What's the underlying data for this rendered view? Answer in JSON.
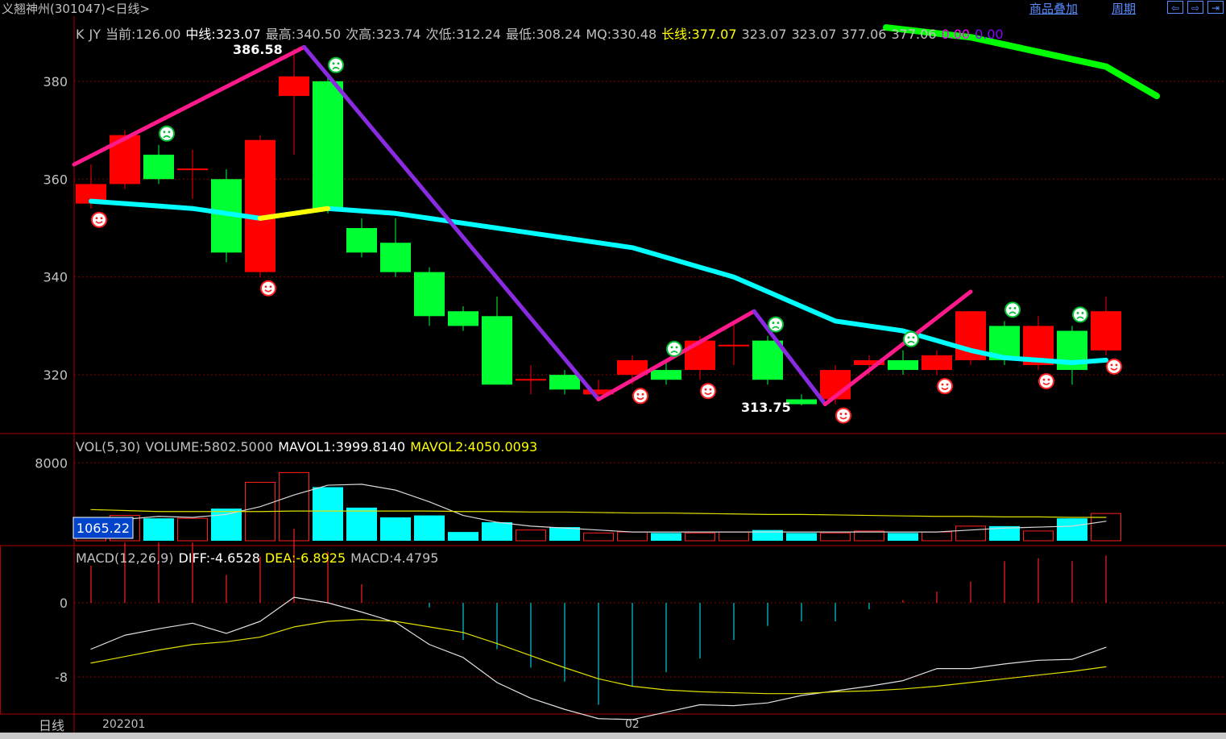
{
  "window": {
    "title": "义翘神州(301047)<日线>",
    "links": [
      "商品叠加",
      "周期"
    ],
    "nav_buttons": [
      "⇦",
      "⇨",
      "⇥"
    ]
  },
  "price_panel": {
    "header": {
      "k_label": "K",
      "jy_label": "JY",
      "current": "当前:126.00",
      "mid": "中线:323.07",
      "high": "最高:340.50",
      "sub_high": "次高:323.74",
      "sub_low": "次低:312.24",
      "low": "最低:308.24",
      "mq": "MQ:330.48",
      "long": "长线:377.07",
      "v1": "323.07",
      "v2": "323.07",
      "v3": "377.06",
      "v4": "377.06",
      "v5": "0.00",
      "v6": "0.00"
    },
    "y_ticks": [
      "380",
      "360",
      "340",
      "320"
    ],
    "annotations": {
      "peak": "386.58",
      "trough": "313.75"
    }
  },
  "volume_panel": {
    "header": {
      "name": "VOL(5,30)",
      "volume": "VOLUME:5802.5000",
      "mavol1": "MAVOL1:3999.8140",
      "mavol2": "MAVOL2:4050.0093"
    },
    "y_ticks": [
      "8000"
    ],
    "cursor_value": "1065.22"
  },
  "macd_panel": {
    "header": {
      "name": "MACD(12,26,9)",
      "diff": "DIFF:-4.6528",
      "dea": "DEA:-6.8925",
      "macd": "MACD:4.4795"
    },
    "y_ticks": [
      "0",
      "-8"
    ]
  },
  "footer": {
    "period": "日线",
    "x_labels": [
      "202201",
      "02"
    ]
  },
  "colors": {
    "up": "#ff0000",
    "down": "#00ff33",
    "ma_cyan": "#00ffff",
    "ma_yellow": "#ffff00",
    "zig_pink": "#ff1a8c",
    "zig_purple": "#8a2be2",
    "long_green": "#00ff00",
    "vol_cyan": "#00ffff",
    "grid": "#8b0000"
  },
  "chart_data": {
    "type": "candlestick",
    "candles": [
      {
        "o": 355,
        "c": 359,
        "h": 363,
        "l": 354,
        "mark": "smile-below"
      },
      {
        "o": 359,
        "c": 369,
        "h": 370,
        "l": 358,
        "mark": ""
      },
      {
        "o": 365,
        "c": 360,
        "h": 367,
        "l": 359,
        "mark": "frown-above"
      },
      {
        "o": 362,
        "c": 362,
        "h": 366,
        "l": 356,
        "mark": ""
      },
      {
        "o": 360,
        "c": 345,
        "h": 362,
        "l": 343,
        "mark": ""
      },
      {
        "o": 341,
        "c": 368,
        "h": 369,
        "l": 340,
        "mark": "smile-below"
      },
      {
        "o": 377,
        "c": 381,
        "h": 386.58,
        "l": 365,
        "mark": ""
      },
      {
        "o": 380,
        "c": 354,
        "h": 381,
        "l": 353,
        "mark": "frown-above"
      },
      {
        "o": 350,
        "c": 345,
        "h": 352,
        "l": 344,
        "mark": ""
      },
      {
        "o": 347,
        "c": 341,
        "h": 352,
        "l": 340,
        "mark": ""
      },
      {
        "o": 341,
        "c": 332,
        "h": 342,
        "l": 330,
        "mark": ""
      },
      {
        "o": 333,
        "c": 330,
        "h": 334,
        "l": 329,
        "mark": ""
      },
      {
        "o": 332,
        "c": 318,
        "h": 336,
        "l": 318,
        "mark": ""
      },
      {
        "o": 319,
        "c": 319,
        "h": 322,
        "l": 316,
        "mark": ""
      },
      {
        "o": 320,
        "c": 317,
        "h": 321,
        "l": 316,
        "mark": ""
      },
      {
        "o": 316,
        "c": 317,
        "h": 319,
        "l": 315,
        "mark": ""
      },
      {
        "o": 320,
        "c": 323,
        "h": 324,
        "l": 318,
        "mark": "smile-below"
      },
      {
        "o": 321,
        "c": 319,
        "h": 323,
        "l": 318,
        "mark": "frown-above"
      },
      {
        "o": 321,
        "c": 327,
        "h": 328,
        "l": 319,
        "mark": "smile-below"
      },
      {
        "o": 326,
        "c": 326,
        "h": 331,
        "l": 322,
        "mark": ""
      },
      {
        "o": 327,
        "c": 319,
        "h": 328,
        "l": 318,
        "mark": "frown-above"
      },
      {
        "o": 315,
        "c": 314,
        "h": 316,
        "l": 313.75,
        "mark": ""
      },
      {
        "o": 315,
        "c": 321,
        "h": 322,
        "l": 314,
        "mark": "smile-below"
      },
      {
        "o": 322,
        "c": 323,
        "h": 324,
        "l": 320,
        "mark": ""
      },
      {
        "o": 323,
        "c": 321,
        "h": 325,
        "l": 320,
        "mark": "frown-above"
      },
      {
        "o": 321,
        "c": 324,
        "h": 325,
        "l": 320,
        "mark": "smile-below"
      },
      {
        "o": 323,
        "c": 333,
        "h": 333,
        "l": 322,
        "mark": ""
      },
      {
        "o": 330,
        "c": 323,
        "h": 331,
        "l": 322,
        "mark": "frown-above"
      },
      {
        "o": 322,
        "c": 330,
        "h": 332,
        "l": 321,
        "mark": "smile-below"
      },
      {
        "o": 329,
        "c": 321,
        "h": 330,
        "l": 318,
        "mark": "frown-above"
      },
      {
        "o": 325,
        "c": 333,
        "h": 336,
        "l": 324,
        "mark": "smile-below"
      }
    ],
    "ma_mid": [
      355.5,
      355,
      354.5,
      354,
      353,
      352,
      353,
      354,
      353.5,
      353,
      352,
      351,
      350,
      349,
      348,
      347,
      346,
      344,
      342,
      340,
      337,
      334,
      331,
      330,
      329,
      327,
      325,
      323.5,
      323,
      322.5,
      323
    ],
    "ma_long": [
      {
        "i": 23.5,
        "v": 391
      },
      {
        "i": 26,
        "v": 389
      },
      {
        "i": 28,
        "v": 386
      },
      {
        "i": 30,
        "v": 383
      },
      {
        "i": 31.5,
        "v": 377
      }
    ],
    "zigzag_pink": [
      {
        "i": -0.5,
        "v": 363
      },
      {
        "i": 6.3,
        "v": 387
      }
    ],
    "zigzag_purple_1": [
      {
        "i": 6.3,
        "v": 387
      },
      {
        "i": 15.0,
        "v": 315
      }
    ],
    "zigzag_pink_2": [
      {
        "i": 15.0,
        "v": 315
      },
      {
        "i": 19.6,
        "v": 333
      }
    ],
    "zigzag_purple_2": [
      {
        "i": 19.6,
        "v": 333
      },
      {
        "i": 21.7,
        "v": 314
      }
    ],
    "zigzag_pink_3": [
      {
        "i": 21.7,
        "v": 314
      },
      {
        "i": 26.0,
        "v": 337
      }
    ],
    "volume": [
      2300,
      2600,
      2300,
      2300,
      3300,
      6000,
      7000,
      5500,
      3400,
      2400,
      2600,
      900,
      1900,
      1100,
      1400,
      800,
      900,
      800,
      800,
      900,
      1100,
      800,
      800,
      1000,
      800,
      900,
      1500,
      1500,
      1000,
      2300,
      2800
    ],
    "mavol1": [
      1800,
      2200,
      2500,
      2400,
      2700,
      3500,
      4700,
      5700,
      5800,
      5200,
      4000,
      2600,
      1900,
      1500,
      1300,
      1100,
      900,
      900,
      900,
      900,
      900,
      900,
      900,
      900,
      900,
      900,
      1100,
      1300,
      1400,
      1500,
      2000
    ],
    "mavol2": [
      3200,
      3100,
      3000,
      3000,
      3000,
      3000,
      3050,
      3050,
      3050,
      3050,
      3050,
      3000,
      3000,
      2950,
      2950,
      2900,
      2850,
      2850,
      2800,
      2750,
      2700,
      2700,
      2650,
      2600,
      2550,
      2500,
      2500,
      2450,
      2450,
      2400,
      2400
    ],
    "macd_hist": [
      4,
      6.5,
      6.5,
      6.5,
      3,
      5,
      8,
      5.5,
      2,
      0,
      -0.5,
      -4,
      -5,
      -7,
      -8.5,
      -11,
      -9,
      -7.5,
      -6,
      -4,
      -2.5,
      -2,
      -2,
      -0.7,
      0.3,
      1.2,
      2.3,
      4.5,
      4.8,
      4.5,
      5.1
    ],
    "macd_diff": [
      -5,
      -3.5,
      -2.8,
      -2.2,
      -3.3,
      -2,
      0.6,
      0,
      -1,
      -2.1,
      -4.5,
      -5.9,
      -8.6,
      -10.3,
      -11.5,
      -12.5,
      -12.6,
      -11.8,
      -11,
      -11.1,
      -10.8,
      -10,
      -9.5,
      -9,
      -8.4,
      -7.1,
      -7.1,
      -6.6,
      -6.2,
      -6.1,
      -4.8
    ],
    "macd_dea": [
      -6.5,
      -5.8,
      -5.1,
      -4.5,
      -4.2,
      -3.7,
      -2.6,
      -2,
      -1.8,
      -2,
      -2.6,
      -3.2,
      -4.4,
      -5.7,
      -7,
      -8.2,
      -9,
      -9.4,
      -9.6,
      -9.7,
      -9.8,
      -9.8,
      -9.6,
      -9.5,
      -9.3,
      -9,
      -8.6,
      -8.2,
      -7.8,
      -7.4,
      -6.9
    ],
    "price_ylim": [
      308,
      392
    ],
    "volume_ylim": [
      0,
      11000
    ],
    "macd_ylim": [
      -12,
      6
    ]
  }
}
